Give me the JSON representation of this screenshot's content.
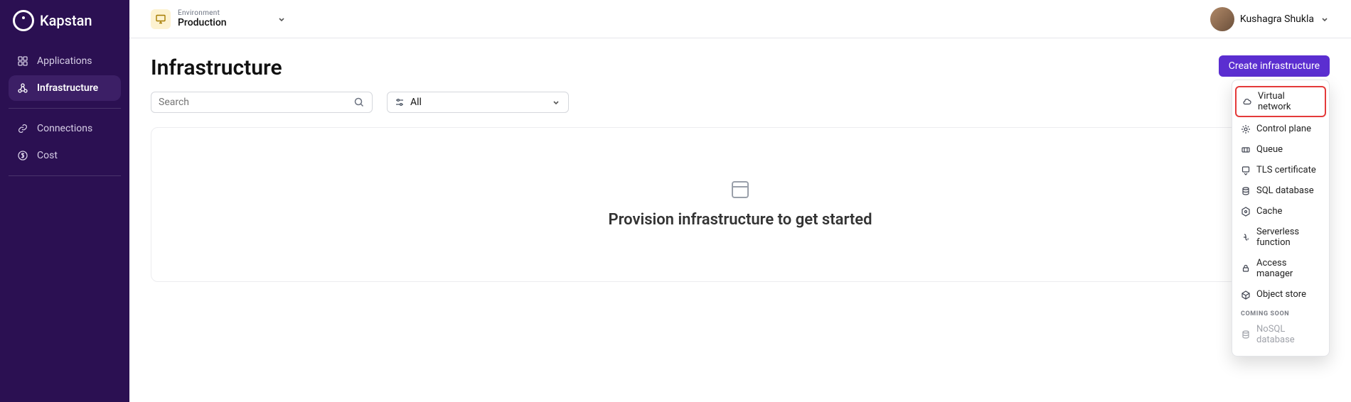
{
  "logo": "Kapstan",
  "sidebar": {
    "items": [
      {
        "label": "Applications"
      },
      {
        "label": "Infrastructure"
      },
      {
        "label": "Connections"
      },
      {
        "label": "Cost"
      }
    ]
  },
  "environment": {
    "label": "Environment",
    "value": "Production"
  },
  "user": {
    "name": "Kushagra Shukla"
  },
  "page": {
    "title": "Infrastructure"
  },
  "search": {
    "placeholder": "Search"
  },
  "filter": {
    "value": "All"
  },
  "create_button": "Create infrastructure",
  "empty_state": "Provision infrastructure to get started",
  "dropdown": {
    "items": [
      {
        "label": "Virtual network"
      },
      {
        "label": "Control plane"
      },
      {
        "label": "Queue"
      },
      {
        "label": "TLS certificate"
      },
      {
        "label": "SQL database"
      },
      {
        "label": "Cache"
      },
      {
        "label": "Serverless function"
      },
      {
        "label": "Access manager"
      },
      {
        "label": "Object store"
      }
    ],
    "section_label": "COMING SOON",
    "disabled": [
      {
        "label": "NoSQL database"
      }
    ]
  }
}
